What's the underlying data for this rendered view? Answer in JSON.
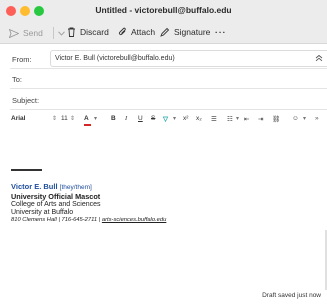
{
  "window": {
    "title": "Untitled - victorebull@buffalo.edu"
  },
  "toolbar": {
    "send_label": "Send",
    "discard_label": "Discard",
    "attach_label": "Attach",
    "signature_label": "Signature",
    "more_label": "···"
  },
  "fields": {
    "from_label": "From:",
    "from_value": "Victor E. Bull (victorebull@buffalo.edu)",
    "to_label": "To:",
    "to_value": "",
    "subject_label": "Subject:",
    "subject_value": ""
  },
  "format_bar": {
    "font": "Arial",
    "size": "11",
    "color_glyph": "A",
    "bold": "B",
    "italic": "I",
    "underline": "U",
    "strikethrough": "S",
    "superscript": "x²",
    "subscript": "x₂"
  },
  "signature": {
    "name": "Victor E. Bull",
    "pronouns": "[they/them]",
    "role": "University Official Mascot",
    "college": "College of Arts and Sciences",
    "university": "University at Buffalo",
    "address_phone": "810 Clemens Hall | 716-645-2711 | ",
    "website": "arts-sciences.buffalo.edu"
  },
  "status": {
    "text": "Draft saved just now"
  },
  "colors": {
    "signature_name": "#1f4e9e",
    "text_color_underline": "#d62728",
    "highlight": "#1aa6a6"
  },
  "icons": [
    "send-icon",
    "chevron-down-icon",
    "trash-icon",
    "paperclip-icon",
    "signature-pen-icon",
    "more-icon",
    "collapse-icon"
  ]
}
